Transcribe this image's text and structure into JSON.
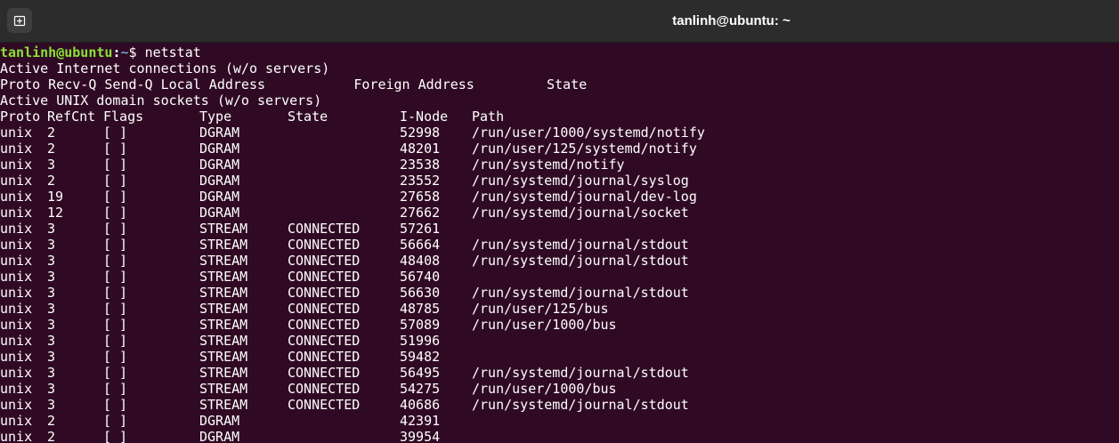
{
  "window": {
    "title": "tanlinh@ubuntu: ~"
  },
  "prompt": {
    "user_host": "tanlinh@ubuntu",
    "separator": ":",
    "path": "~",
    "symbol": "$ ",
    "command": "netstat"
  },
  "output": {
    "inet_heading": "Active Internet connections (w/o servers)",
    "inet_columns": "Proto Recv-Q Send-Q Local Address           Foreign Address         State",
    "unix_heading": "Active UNIX domain sockets (w/o servers)",
    "unix_columns": [
      "Proto",
      "RefCnt",
      "Flags",
      "Type",
      "State",
      "I-Node",
      "Path"
    ],
    "rows": [
      [
        "unix",
        "2",
        "[ ]",
        "DGRAM",
        "",
        "52998",
        "/run/user/1000/systemd/notify"
      ],
      [
        "unix",
        "2",
        "[ ]",
        "DGRAM",
        "",
        "48201",
        "/run/user/125/systemd/notify"
      ],
      [
        "unix",
        "3",
        "[ ]",
        "DGRAM",
        "",
        "23538",
        "/run/systemd/notify"
      ],
      [
        "unix",
        "2",
        "[ ]",
        "DGRAM",
        "",
        "23552",
        "/run/systemd/journal/syslog"
      ],
      [
        "unix",
        "19",
        "[ ]",
        "DGRAM",
        "",
        "27658",
        "/run/systemd/journal/dev-log"
      ],
      [
        "unix",
        "12",
        "[ ]",
        "DGRAM",
        "",
        "27662",
        "/run/systemd/journal/socket"
      ],
      [
        "unix",
        "3",
        "[ ]",
        "STREAM",
        "CONNECTED",
        "57261",
        ""
      ],
      [
        "unix",
        "3",
        "[ ]",
        "STREAM",
        "CONNECTED",
        "56664",
        "/run/systemd/journal/stdout"
      ],
      [
        "unix",
        "3",
        "[ ]",
        "STREAM",
        "CONNECTED",
        "48408",
        "/run/systemd/journal/stdout"
      ],
      [
        "unix",
        "3",
        "[ ]",
        "STREAM",
        "CONNECTED",
        "56740",
        ""
      ],
      [
        "unix",
        "3",
        "[ ]",
        "STREAM",
        "CONNECTED",
        "56630",
        "/run/systemd/journal/stdout"
      ],
      [
        "unix",
        "3",
        "[ ]",
        "STREAM",
        "CONNECTED",
        "48785",
        "/run/user/125/bus"
      ],
      [
        "unix",
        "3",
        "[ ]",
        "STREAM",
        "CONNECTED",
        "57089",
        "/run/user/1000/bus"
      ],
      [
        "unix",
        "3",
        "[ ]",
        "STREAM",
        "CONNECTED",
        "51996",
        ""
      ],
      [
        "unix",
        "3",
        "[ ]",
        "STREAM",
        "CONNECTED",
        "59482",
        ""
      ],
      [
        "unix",
        "3",
        "[ ]",
        "STREAM",
        "CONNECTED",
        "56495",
        "/run/systemd/journal/stdout"
      ],
      [
        "unix",
        "3",
        "[ ]",
        "STREAM",
        "CONNECTED",
        "54275",
        "/run/user/1000/bus"
      ],
      [
        "unix",
        "3",
        "[ ]",
        "STREAM",
        "CONNECTED",
        "40686",
        "/run/systemd/journal/stdout"
      ],
      [
        "unix",
        "2",
        "[ ]",
        "DGRAM",
        "",
        "42391",
        ""
      ],
      [
        "unix",
        "2",
        "[ ]",
        "DGRAM",
        "",
        "39954",
        ""
      ]
    ]
  },
  "icons": {
    "new_tab": "new-tab-icon"
  },
  "colors": {
    "background": "#300a24",
    "titlebar": "#2c2c2c",
    "prompt_user": "#8ae234",
    "prompt_path": "#729fcf",
    "text": "#ffffff"
  }
}
